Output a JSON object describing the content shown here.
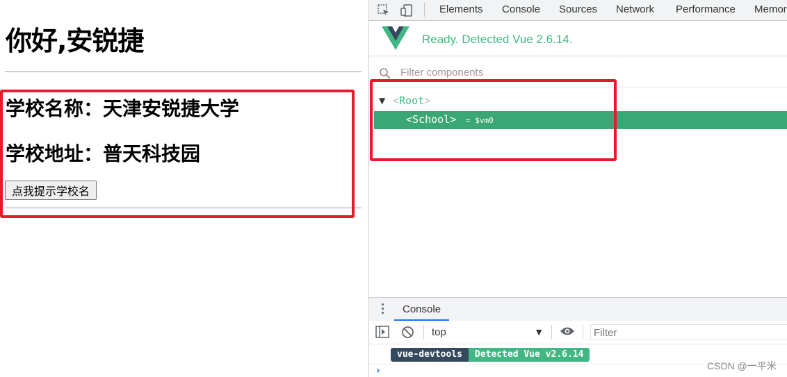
{
  "page": {
    "heading": "你好,安锐捷",
    "school_name": "学校名称：天津安锐捷大学",
    "school_address": "学校地址：普天科技园",
    "button_label": "点我提示学校名"
  },
  "devtools": {
    "tabs": [
      "Elements",
      "Console",
      "Sources",
      "Network",
      "Performance",
      "Memor"
    ],
    "vue_status": "Ready. Detected Vue 2.6.14.",
    "filter_placeholder": "Filter components",
    "tree": {
      "root_label": "Root",
      "selected_label": "School",
      "selected_ref": "= $vm0"
    },
    "drawer": {
      "tab_label": "Console",
      "context": "top",
      "filter_placeholder": "Filter",
      "badge_left": "vue-devtools",
      "badge_right": "Detected Vue v2.6.14",
      "prompt": "›"
    },
    "watermark": "CSDN @一平米"
  },
  "colors": {
    "vue_green": "#42b983",
    "selected_row": "#3ba776",
    "highlight_box": "#e8192c",
    "badge_dark": "#35495e"
  }
}
